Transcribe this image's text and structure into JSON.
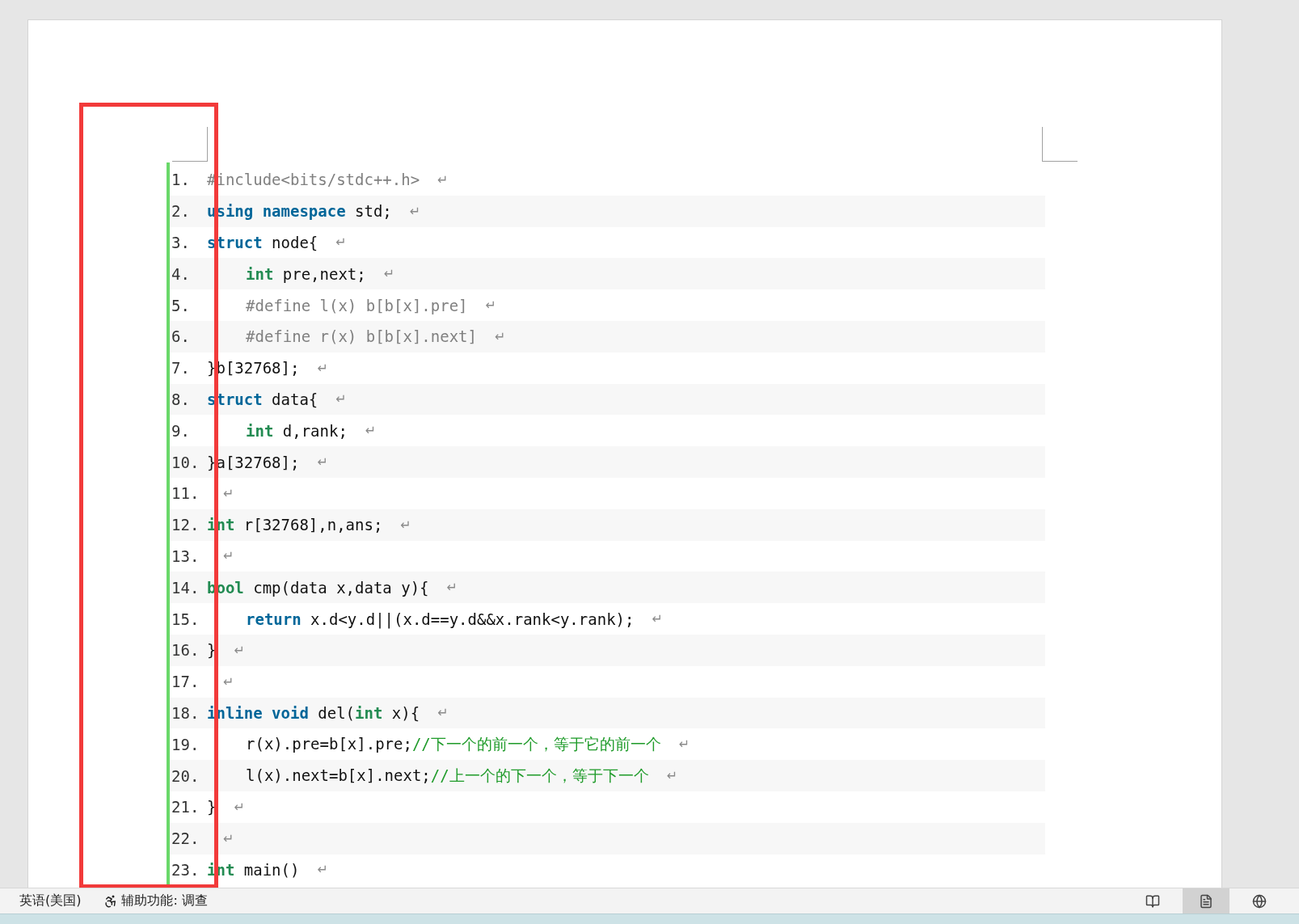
{
  "document": {
    "lines": [
      {
        "number": "1.",
        "indent": false,
        "tokens": [
          {
            "kind": "preproc",
            "text": "#include<bits/stdc++.h>"
          }
        ],
        "end": "↵"
      },
      {
        "number": "2.",
        "indent": false,
        "tokens": [
          {
            "kind": "keyword",
            "text": "using namespace"
          },
          {
            "kind": "plain",
            "text": " std;"
          }
        ],
        "end": "↵"
      },
      {
        "number": "3.",
        "indent": false,
        "tokens": [
          {
            "kind": "keyword",
            "text": "struct"
          },
          {
            "kind": "plain",
            "text": " node{"
          }
        ],
        "end": "↵"
      },
      {
        "number": "4.",
        "indent": true,
        "tokens": [
          {
            "kind": "type",
            "text": "int"
          },
          {
            "kind": "plain",
            "text": " pre,next;"
          }
        ],
        "end": "↵"
      },
      {
        "number": "5.",
        "indent": true,
        "tokens": [
          {
            "kind": "preproc",
            "text": "#define l(x) b[b[x].pre]"
          }
        ],
        "end": "↵"
      },
      {
        "number": "6.",
        "indent": true,
        "tokens": [
          {
            "kind": "preproc",
            "text": "#define r(x) b[b[x].next]"
          }
        ],
        "end": "↵"
      },
      {
        "number": "7.",
        "indent": false,
        "tokens": [
          {
            "kind": "plain",
            "text": "}b[32768];"
          }
        ],
        "end": "↵"
      },
      {
        "number": "8.",
        "indent": false,
        "tokens": [
          {
            "kind": "keyword",
            "text": "struct"
          },
          {
            "kind": "plain",
            "text": " data{"
          }
        ],
        "end": "↵"
      },
      {
        "number": "9.",
        "indent": true,
        "tokens": [
          {
            "kind": "type",
            "text": "int"
          },
          {
            "kind": "plain",
            "text": " d,rank;"
          }
        ],
        "end": "↵"
      },
      {
        "number": "10.",
        "indent": false,
        "tokens": [
          {
            "kind": "plain",
            "text": "}a[32768];"
          }
        ],
        "end": "↵"
      },
      {
        "number": "11.",
        "end": "↵"
      },
      {
        "number": "12.",
        "indent": false,
        "tokens": [
          {
            "kind": "type",
            "text": "int"
          },
          {
            "kind": "plain",
            "text": " r[32768],n,ans;"
          }
        ],
        "end": "↵"
      },
      {
        "number": "13.",
        "end": "↵"
      },
      {
        "number": "14.",
        "indent": false,
        "tokens": [
          {
            "kind": "type",
            "text": "bool"
          },
          {
            "kind": "plain",
            "text": " cmp(data x,data y){"
          }
        ],
        "end": "↵"
      },
      {
        "number": "15.",
        "indent": true,
        "tokens": [
          {
            "kind": "keyword",
            "text": "return"
          },
          {
            "kind": "plain",
            "text": " x.d<y.d||(x.d==y.d&&x.rank<y.rank);"
          }
        ],
        "end": "↵"
      },
      {
        "number": "16.",
        "indent": false,
        "tokens": [
          {
            "kind": "plain",
            "text": "}"
          }
        ],
        "end": "↵"
      },
      {
        "number": "17.",
        "end": "↵"
      },
      {
        "number": "18.",
        "indent": false,
        "tokens": [
          {
            "kind": "keyword",
            "text": "inline void"
          },
          {
            "kind": "plain",
            "text": " del("
          },
          {
            "kind": "type",
            "text": "int"
          },
          {
            "kind": "plain",
            "text": " x){"
          }
        ],
        "end": "↵"
      },
      {
        "number": "19.",
        "indent": true,
        "tokens": [
          {
            "kind": "plain",
            "text": "r(x).pre=b[x].pre;"
          },
          {
            "kind": "comment",
            "text": "//下一个的前一个，等于它的前一个"
          }
        ],
        "end": "↵"
      },
      {
        "number": "20.",
        "indent": true,
        "tokens": [
          {
            "kind": "plain",
            "text": "l(x).next=b[x].next;"
          },
          {
            "kind": "comment",
            "text": "//上一个的下一个，等于下一个"
          }
        ],
        "end": "↵"
      },
      {
        "number": "21.",
        "indent": false,
        "tokens": [
          {
            "kind": "plain",
            "text": "}"
          }
        ],
        "end": "↵"
      },
      {
        "number": "22.",
        "end": "↵"
      },
      {
        "number": "23.",
        "indent": false,
        "tokens": [
          {
            "kind": "type",
            "text": "int"
          },
          {
            "kind": "plain",
            "text": " main()"
          }
        ],
        "end": "↵"
      }
    ]
  },
  "status_bar": {
    "language": "英语(美国)",
    "accessibility": "辅助功能: 调查",
    "views": [
      {
        "kind": "read",
        "selected": false
      },
      {
        "kind": "print",
        "selected": true
      },
      {
        "kind": "web",
        "selected": false
      }
    ]
  }
}
